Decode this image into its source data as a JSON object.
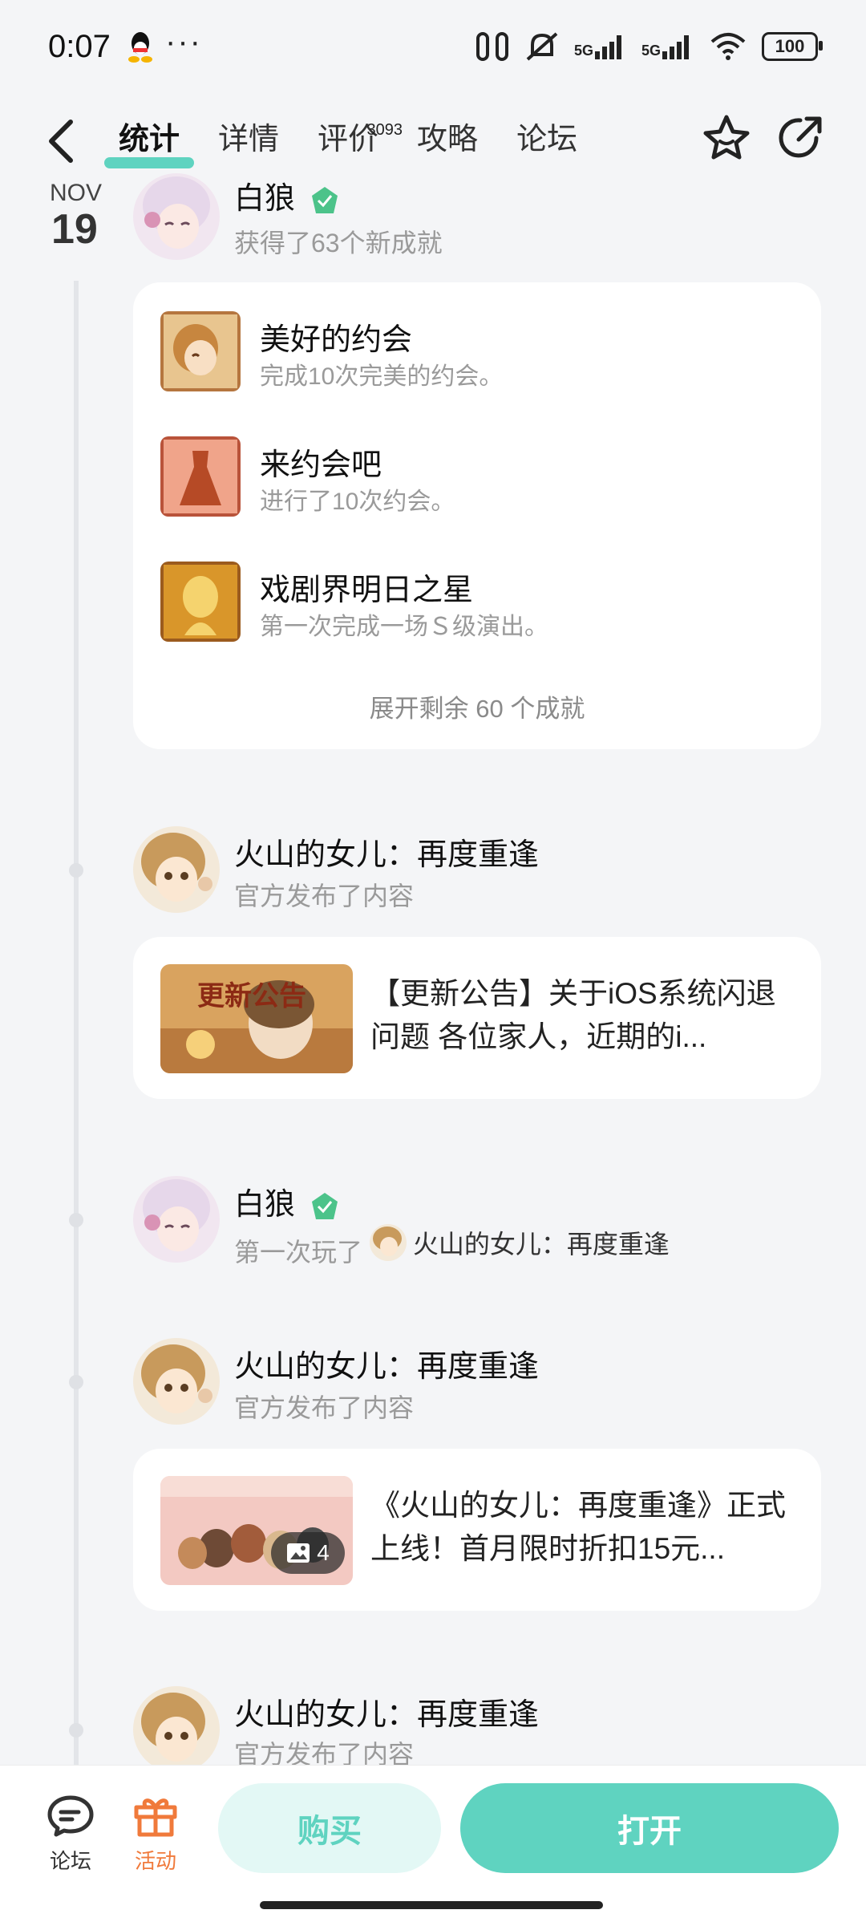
{
  "status_bar": {
    "time": "0:07",
    "dots": "···",
    "network_1": "5G",
    "network_2": "5G",
    "battery": "100"
  },
  "header": {
    "tabs": [
      {
        "label": "统计",
        "active": true
      },
      {
        "label": "详情"
      },
      {
        "label": "评价",
        "badge": "3093"
      },
      {
        "label": "攻略"
      },
      {
        "label": "论坛"
      }
    ]
  },
  "timeline": {
    "date": {
      "month": "NOV",
      "day": "19"
    },
    "entries": [
      {
        "user": "白狼",
        "subtitle": "获得了63个新成就",
        "achievements": [
          {
            "title": "美好的约会",
            "desc": "完成10次完美的约会。"
          },
          {
            "title": "来约会吧",
            "desc": "进行了10次约会。"
          },
          {
            "title": "戏剧界明日之星",
            "desc": "第一次完成一场Ｓ级演出。"
          }
        ],
        "expand_label": "展开剩余 60 个成就"
      },
      {
        "user": "火山的女儿：再度重逢",
        "subtitle": "官方发布了内容",
        "post_text": "【更新公告】关于iOS系统闪退问题 各位家人，近期的i...",
        "thumb_title": "更新公告"
      },
      {
        "user": "白狼",
        "subtitle_prefix": "第一次玩了",
        "game_name": "火山的女儿：再度重逢"
      },
      {
        "user": "火山的女儿：再度重逢",
        "subtitle": "官方发布了内容",
        "post_text": "《火山的女儿：再度重逢》正式上线！首月限时折扣15元...",
        "image_count": "4"
      },
      {
        "user": "火山的女儿：再度重逢",
        "subtitle": "官方发布了内容"
      }
    ]
  },
  "bottom_bar": {
    "forum_label": "论坛",
    "activity_label": "活动",
    "buy_label": "购买",
    "open_label": "打开"
  },
  "colors": {
    "accent": "#5fd3c0",
    "accent_light": "#e3f8f5",
    "activity": "#f07a3b",
    "badge_green": "#4cc38a"
  }
}
